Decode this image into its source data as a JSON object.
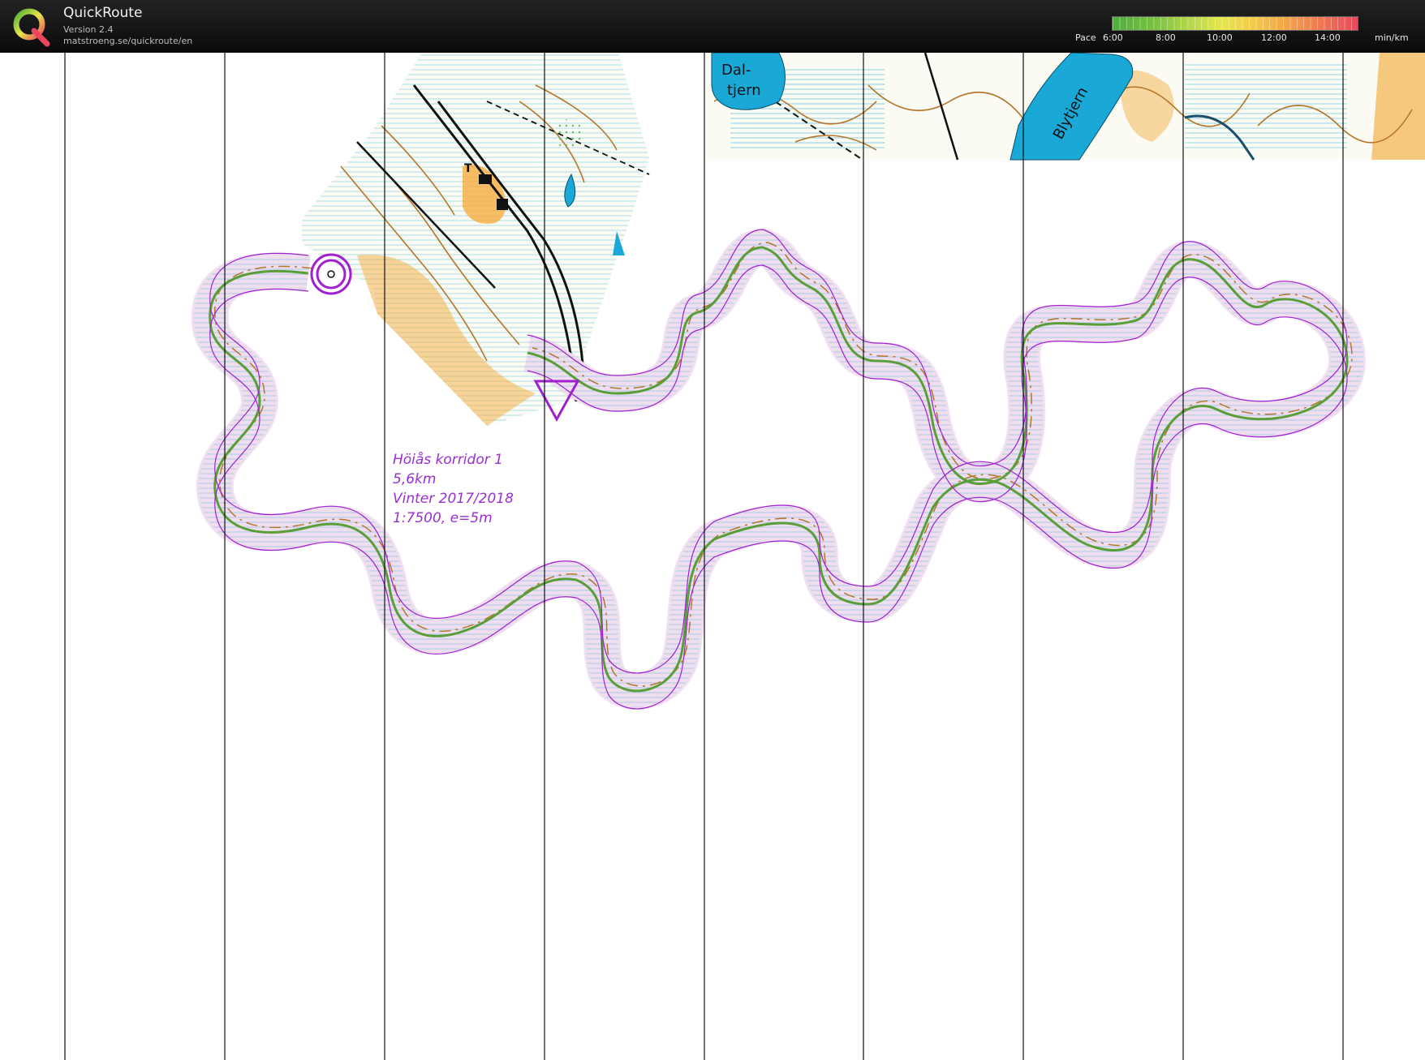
{
  "app": {
    "title": "QuickRoute",
    "version": "Version 2.4",
    "url": "matstroeng.se/quickroute/en"
  },
  "pace_legend": {
    "label": "Pace",
    "ticks": [
      "6:00",
      "8:00",
      "10:00",
      "12:00",
      "14:00"
    ],
    "unit": "min/km"
  },
  "map": {
    "lake_labels": [
      "Dal-",
      "tjern",
      "Blytjern"
    ],
    "feature_label": "T",
    "course_text": {
      "line1": "Höiås korridor 1",
      "line2": "5,6km",
      "line3": "Vinter 2017/2018",
      "line4": "1:7500, e=5m"
    }
  },
  "colors": {
    "course": "#a020d0",
    "route": "#5a9e3a",
    "contour": "#b5762a",
    "water": "#1aa9d6",
    "open_land": "#f4b24b"
  }
}
